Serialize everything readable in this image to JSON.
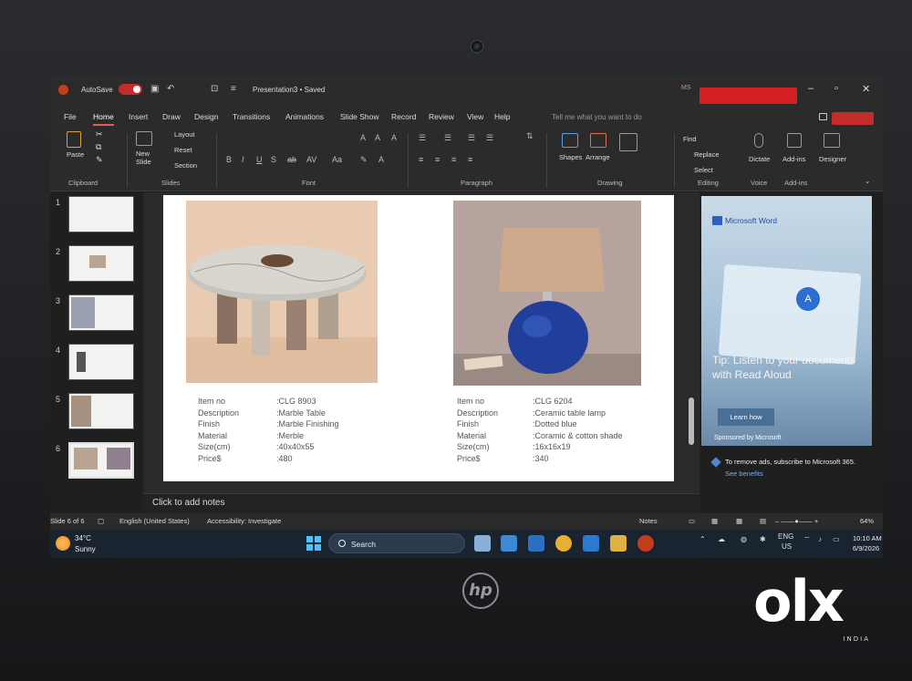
{
  "titlebar": {
    "autosave_label": "AutoSave",
    "filename": "Presentation3 • Saved",
    "user_initials": "MS"
  },
  "menu": {
    "tabs": [
      "File",
      "Home",
      "Insert",
      "Draw",
      "Design",
      "Transitions",
      "Animations",
      "Slide Show",
      "Record",
      "Review",
      "View",
      "Help"
    ],
    "active_tab": "Home",
    "tell_me": "Tell me what you want to do"
  },
  "ribbon": {
    "paste": "Paste",
    "new_slide": "New Slide",
    "layout": "Layout",
    "reset": "Reset",
    "section": "Section",
    "shapes": "Shapes",
    "arrange": "Arrange",
    "find": "Find",
    "replace": "Replace",
    "select": "Select",
    "dictate": "Dictate",
    "addins": "Add-ins",
    "designer": "Designer",
    "groups": {
      "clipboard": "Clipboard",
      "slides": "Slides",
      "font": "Font",
      "paragraph": "Paragraph",
      "drawing": "Drawing",
      "editing": "Editing",
      "voice": "Voice",
      "addins": "Add-ins"
    }
  },
  "thumbnails": [
    "1",
    "2",
    "3",
    "4",
    "5",
    "6"
  ],
  "active_slide": 6,
  "slide": {
    "items": [
      {
        "labels": [
          "Item no",
          "Description",
          "Finish",
          "Material",
          "Size(cm)",
          "Price$"
        ],
        "values": [
          ":CLG 8903",
          ":Marble Table",
          ":Marble Finishing",
          ":Merble",
          ":40x40x55",
          ":480"
        ]
      },
      {
        "labels": [
          "Item no",
          "Description",
          "Finish",
          "Material",
          "Size(cm)",
          "Price$"
        ],
        "values": [
          ":CLG 6204",
          ":Ceramic table lamp",
          ":Dotted blue",
          ":Coramic & cotton shade",
          ":16x16x19",
          ":340"
        ]
      }
    ]
  },
  "notes_placeholder": "Click to add notes",
  "status": {
    "slide_count": "Slide 6 of 6",
    "language": "English (United States)",
    "accessibility": "Accessibility: Investigate",
    "notes": "Notes",
    "zoom": "64%"
  },
  "ad": {
    "brand": "Microsoft Word",
    "tip": "Tip: Listen to your documents with Read Aloud",
    "button": "Learn how",
    "sponsor": "Sponsored by Microsoft",
    "remove": "To remove ads, subscribe to Microsoft 365.",
    "benefits": "See benefits"
  },
  "taskbar": {
    "temp": "34°C",
    "weather": "Sunny",
    "search": "Search",
    "lang1": "ENG",
    "lang2": "US",
    "time": "10:10 AM",
    "date": "6/9/2026"
  },
  "watermark": {
    "brand": "olx",
    "region": "INDIA"
  },
  "device_logo": "hp"
}
